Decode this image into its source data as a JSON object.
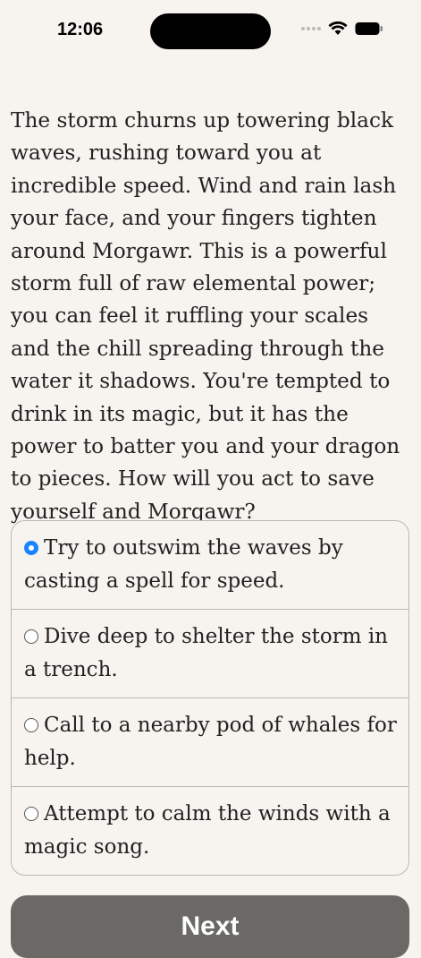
{
  "status_bar": {
    "time": "12:06"
  },
  "story": {
    "text": "The storm churns up towering black waves, rushing toward you at incredible speed. Wind and rain lash your face, and your fingers tighten around Morgawr. This is a powerful storm full of raw elemental power; you can feel it ruffling your scales and the chill spreading through the water it shadows. You're tempted to drink in its magic, but it has the power to batter you and your dragon to pieces. How will you act to save yourself and Morgawr?"
  },
  "choices": [
    {
      "label": "Try to outswim the waves by casting a spell for speed.",
      "selected": true
    },
    {
      "label": "Dive deep to shelter the storm in a trench.",
      "selected": false
    },
    {
      "label": "Call to a nearby pod of whales for help.",
      "selected": false
    },
    {
      "label": "Attempt to calm the winds with a magic song.",
      "selected": false
    }
  ],
  "next_button": {
    "label": "Next"
  },
  "colors": {
    "background": "#f7f3ef",
    "accent": "#1a84ff",
    "button": "#6b6966"
  }
}
